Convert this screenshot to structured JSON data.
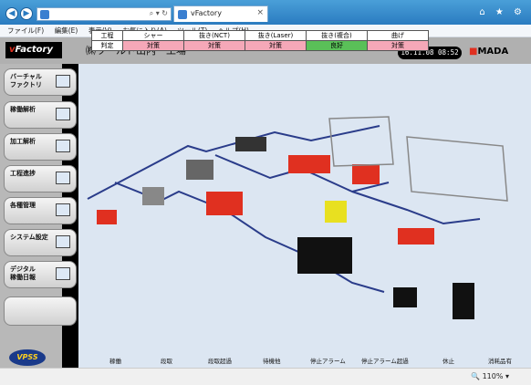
{
  "browser": {
    "tab_title": "vFactory",
    "menu": [
      "ファイル(F)",
      "編集(E)",
      "表示(V)",
      "お気に入り(A)",
      "ツール(T)",
      "ヘルプ(H)"
    ],
    "zoom": "110%"
  },
  "app": {
    "logo_text": "vFactory",
    "plant_name": "㈱ワールド山内　工場",
    "clock": "16.11.08 08:52",
    "brand": "AMADA"
  },
  "sidebar": {
    "items": [
      {
        "label": "バーチャル\nファクトリ"
      },
      {
        "label": "稼働解析"
      },
      {
        "label": "加工解析"
      },
      {
        "label": "工程進捗"
      },
      {
        "label": "各種管理"
      },
      {
        "label": "システム設定"
      },
      {
        "label": "デジタル\n稼働日報"
      }
    ],
    "footer_logo": "VPSS"
  },
  "status_table": {
    "row_labels": [
      "工程",
      "判定"
    ],
    "columns": [
      {
        "process": "シャー",
        "judgment": "対策",
        "status_color": "#f5a8b8"
      },
      {
        "process": "抜き(NCT)",
        "judgment": "対策",
        "status_color": "#f5a8b8"
      },
      {
        "process": "抜き(Laser)",
        "judgment": "対策",
        "status_color": "#f5a8b8"
      },
      {
        "process": "抜き(複合)",
        "judgment": "良好",
        "status_color": "#5ac058"
      },
      {
        "process": "曲げ",
        "judgment": "対策",
        "status_color": "#f5a8b8"
      }
    ]
  },
  "legend": [
    {
      "label": "稼働",
      "color": "#777777"
    },
    {
      "label": "段取",
      "color": "#e8e020"
    },
    {
      "label": "段取超過",
      "color": "#e8e020"
    },
    {
      "label": "待機他",
      "color": "#e8e020"
    },
    {
      "label": "停止アラーム",
      "color": "#e03020"
    },
    {
      "label": "停止アラーム超過",
      "color": "#e03020"
    },
    {
      "label": "休止",
      "color": "#999999"
    },
    {
      "label": "消耗品有",
      "color": "#777777"
    }
  ]
}
